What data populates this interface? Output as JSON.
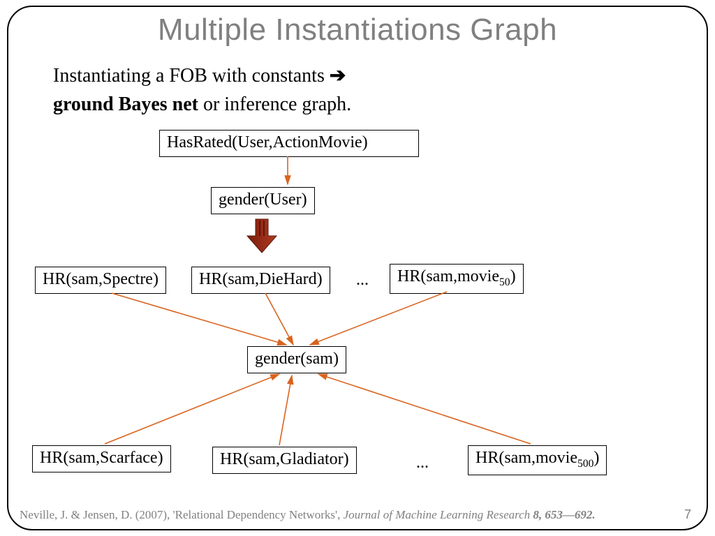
{
  "title": "Multiple Instantiations Graph",
  "subtitle": {
    "line1_pre": "Instantiating a FOB with constants ",
    "line1_arrow": "➔",
    "line2_bold": "ground Bayes net",
    "line2_rest": " or inference graph."
  },
  "nodes": {
    "top1": "HasRated(User,ActionMovie)",
    "top2": "gender(User)",
    "row1a": "HR(sam,Spectre)",
    "row1b": "HR(sam,DieHard)",
    "row1c_pre": "HR(sam,movie",
    "row1c_sub": "50",
    "row1c_post": ")",
    "center": "gender(sam)",
    "row2a": "HR(sam,Scarface)",
    "row2b": "HR(sam,Gladiator)",
    "row2c_pre": "HR(sam,movie",
    "row2c_sub": "500",
    "row2c_post": ")"
  },
  "ellipsis": "...",
  "citation": {
    "text": "Neville, J. & Jensen, D. (2007), 'Relational Dependency Networks', ",
    "journal": "Journal of Machine Learning Research ",
    "vol": "8, 653—692."
  },
  "page": "7",
  "chart_data": {
    "type": "diagram",
    "description": "Bayes net instantiation graph",
    "edges": [
      {
        "from": "HasRated(User,ActionMovie)",
        "to": "gender(User)"
      },
      {
        "from": "gender(User)",
        "to": "instantiation",
        "style": "block-arrow"
      },
      {
        "from": "HR(sam,Spectre)",
        "to": "gender(sam)"
      },
      {
        "from": "HR(sam,DieHard)",
        "to": "gender(sam)"
      },
      {
        "from": "HR(sam,movie_50)",
        "to": "gender(sam)"
      },
      {
        "from": "HR(sam,Scarface)",
        "to": "gender(sam)"
      },
      {
        "from": "HR(sam,Gladiator)",
        "to": "gender(sam)"
      },
      {
        "from": "HR(sam,movie_500)",
        "to": "gender(sam)"
      }
    ]
  }
}
